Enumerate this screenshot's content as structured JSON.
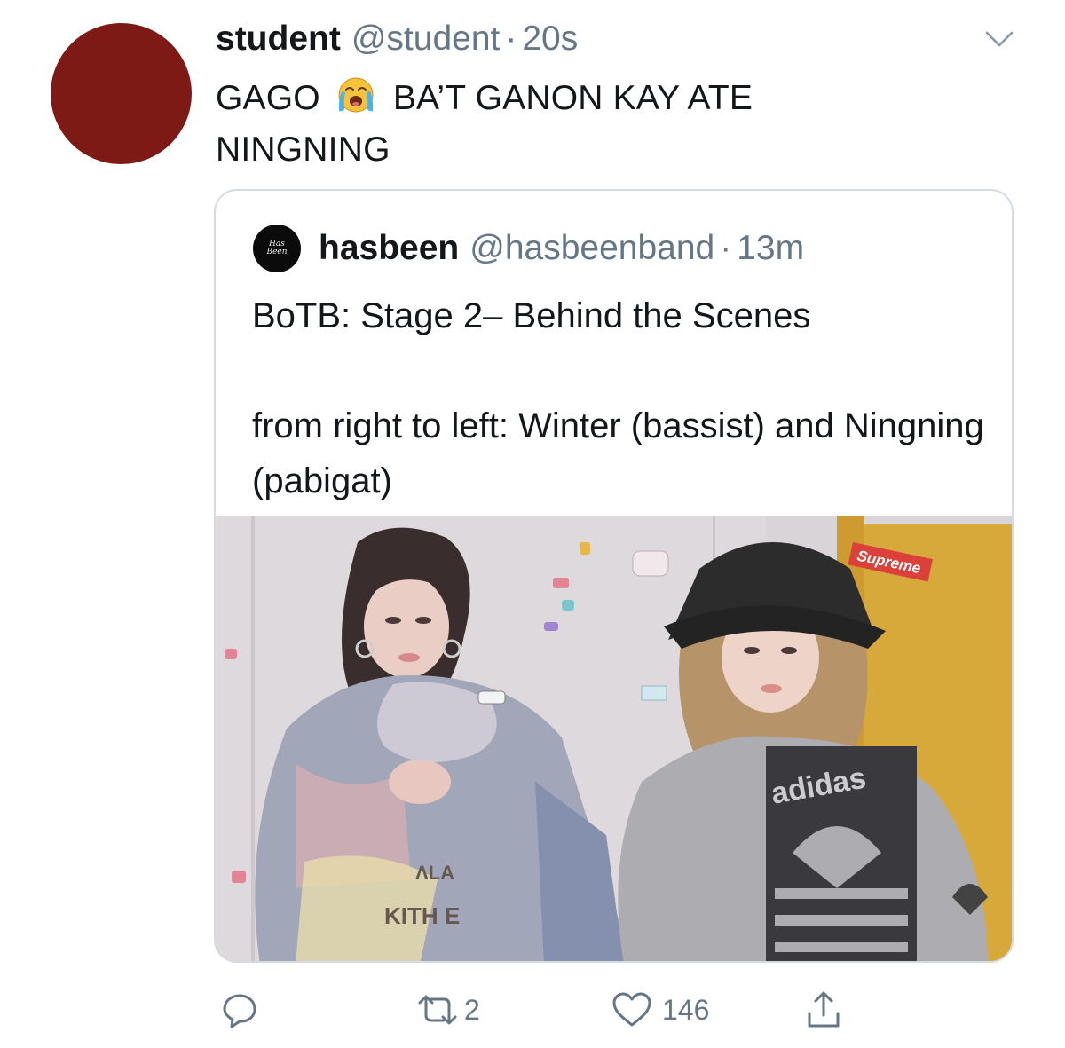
{
  "tweet": {
    "display_name": "student",
    "handle": "@student",
    "separator": "·",
    "time": "20s",
    "text_before_emoji": "GAGO",
    "emoji": "loudly-crying-face",
    "text_after_emoji": "BA’T GANON KAY ATE",
    "text_line2": "NINGNING",
    "avatar_color": "#7e1a16"
  },
  "quote": {
    "avatar_text_top": "Has",
    "avatar_text_bottom": "Been",
    "display_name": "hasbeen",
    "handle": "@hasbeenband",
    "separator": "·",
    "time": "13m",
    "text": "BoTB: Stage 2– Behind the Scenes\n\nfrom right to left: Winter (bassist) and Ningning (pabigat)",
    "photo": {
      "sticker_text": "Supreme",
      "sweater_text": "adidas",
      "hoodie_text_1": "ΛLA",
      "hoodie_text_2": "KITH E"
    }
  },
  "actions": {
    "reply_count": "",
    "retweet_count": "2",
    "like_count": "146"
  },
  "colors": {
    "text": "#14171a",
    "secondary": "#657786",
    "border": "#d5dbe1"
  }
}
